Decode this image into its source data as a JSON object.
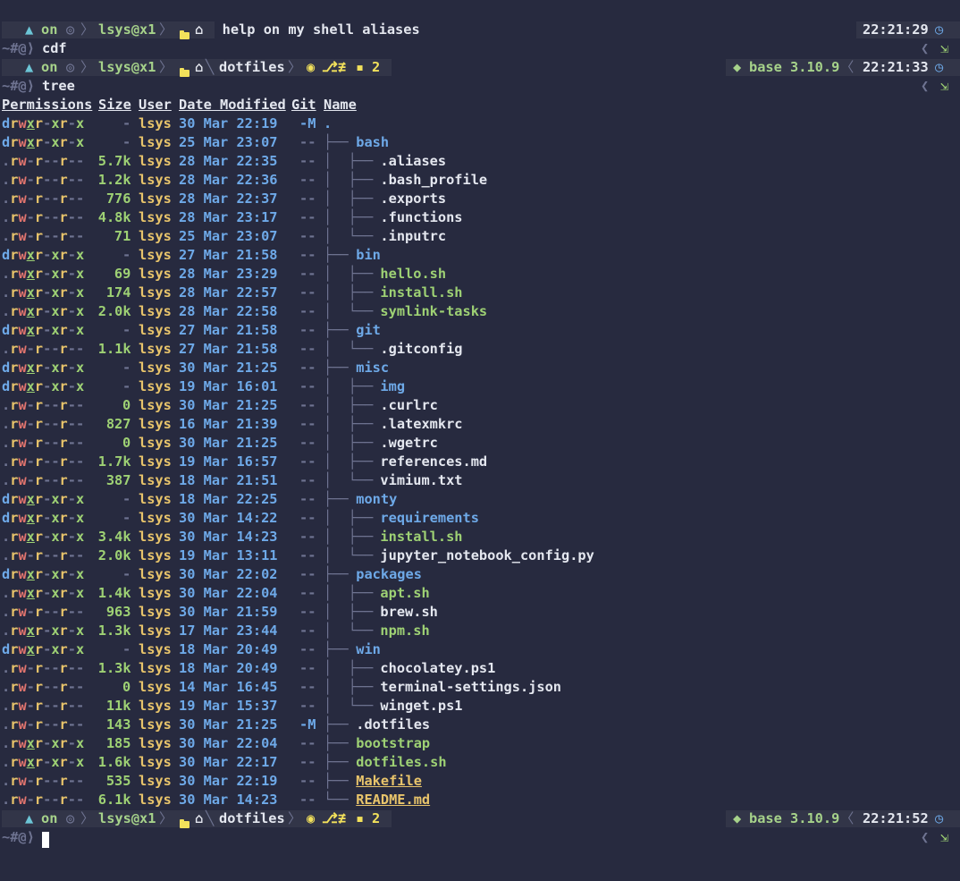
{
  "intro": "Type 'ahelp' for quick help on my shell aliases",
  "prompt": {
    "os_icon": "▲",
    "on": "on",
    "ssh_icon": "◎",
    "user_host": "lsys@x1",
    "folder_icon": "folder-icon",
    "home_icon": "⌂",
    "dir": "dotfiles",
    "git_icon": "",
    "git_branch_icon": "",
    "git_diverge_icon": "≢",
    "git_save_icon": "💾",
    "git_count": "2",
    "python_icon": "🐍",
    "env": "base 3.10.9",
    "clock_icon": "◷",
    "ps": "~#@⟩",
    "right_arrow": "❮",
    "exit_icon": "⇲"
  },
  "prompts": [
    {
      "time": "22:21:29",
      "command": "cdf"
    },
    {
      "time": "22:21:33",
      "command": "tree"
    },
    {
      "time": "22:21:52",
      "command": ""
    }
  ],
  "headers": [
    "Permissions",
    "Size",
    "User",
    "Date Modified",
    "Git",
    "Name"
  ],
  "rows": [
    {
      "perm": "drwxr-xr-x",
      "size": "-",
      "user": "lsys",
      "date": "30 Mar 22:19",
      "git": "-M",
      "tree": "",
      "name": ".",
      "type": "dir"
    },
    {
      "perm": "drwxr-xr-x",
      "size": "-",
      "user": "lsys",
      "date": "25 Mar 23:07",
      "git": "--",
      "tree": "├── ",
      "name": "bash",
      "type": "dir"
    },
    {
      "perm": ".rw-r--r--",
      "size": "5.7k",
      "user": "lsys",
      "date": "28 Mar 22:35",
      "git": "--",
      "tree": "│  ├── ",
      "name": ".aliases",
      "type": "file"
    },
    {
      "perm": ".rw-r--r--",
      "size": "1.2k",
      "user": "lsys",
      "date": "28 Mar 22:36",
      "git": "--",
      "tree": "│  ├── ",
      "name": ".bash_profile",
      "type": "file"
    },
    {
      "perm": ".rw-r--r--",
      "size": "776",
      "user": "lsys",
      "date": "28 Mar 22:37",
      "git": "--",
      "tree": "│  ├── ",
      "name": ".exports",
      "type": "file"
    },
    {
      "perm": ".rw-r--r--",
      "size": "4.8k",
      "user": "lsys",
      "date": "28 Mar 23:17",
      "git": "--",
      "tree": "│  ├── ",
      "name": ".functions",
      "type": "file"
    },
    {
      "perm": ".rw-r--r--",
      "size": "71",
      "user": "lsys",
      "date": "25 Mar 23:07",
      "git": "--",
      "tree": "│  └── ",
      "name": ".inputrc",
      "type": "file"
    },
    {
      "perm": "drwxr-xr-x",
      "size": "-",
      "user": "lsys",
      "date": "27 Mar 21:58",
      "git": "--",
      "tree": "├── ",
      "name": "bin",
      "type": "dir"
    },
    {
      "perm": ".rwxr-xr-x",
      "size": "69",
      "user": "lsys",
      "date": "28 Mar 23:29",
      "git": "--",
      "tree": "│  ├── ",
      "name": "hello.sh",
      "type": "exec"
    },
    {
      "perm": ".rwxr-xr-x",
      "size": "174",
      "user": "lsys",
      "date": "28 Mar 22:57",
      "git": "--",
      "tree": "│  ├── ",
      "name": "install.sh",
      "type": "exec"
    },
    {
      "perm": ".rwxr-xr-x",
      "size": "2.0k",
      "user": "lsys",
      "date": "28 Mar 22:58",
      "git": "--",
      "tree": "│  └── ",
      "name": "symlink-tasks",
      "type": "exec"
    },
    {
      "perm": "drwxr-xr-x",
      "size": "-",
      "user": "lsys",
      "date": "27 Mar 21:58",
      "git": "--",
      "tree": "├── ",
      "name": "git",
      "type": "dir"
    },
    {
      "perm": ".rw-r--r--",
      "size": "1.1k",
      "user": "lsys",
      "date": "27 Mar 21:58",
      "git": "--",
      "tree": "│  └── ",
      "name": ".gitconfig",
      "type": "file"
    },
    {
      "perm": "drwxr-xr-x",
      "size": "-",
      "user": "lsys",
      "date": "30 Mar 21:25",
      "git": "--",
      "tree": "├── ",
      "name": "misc",
      "type": "dir"
    },
    {
      "perm": "drwxr-xr-x",
      "size": "-",
      "user": "lsys",
      "date": "19 Mar 16:01",
      "git": "--",
      "tree": "│  ├── ",
      "name": "img",
      "type": "dir"
    },
    {
      "perm": ".rw-r--r--",
      "size": "0",
      "user": "lsys",
      "date": "30 Mar 21:25",
      "git": "--",
      "tree": "│  ├── ",
      "name": ".curlrc",
      "type": "file"
    },
    {
      "perm": ".rw-r--r--",
      "size": "827",
      "user": "lsys",
      "date": "16 Mar 21:39",
      "git": "--",
      "tree": "│  ├── ",
      "name": ".latexmkrc",
      "type": "file"
    },
    {
      "perm": ".rw-r--r--",
      "size": "0",
      "user": "lsys",
      "date": "30 Mar 21:25",
      "git": "--",
      "tree": "│  ├── ",
      "name": ".wgetrc",
      "type": "file"
    },
    {
      "perm": ".rw-r--r--",
      "size": "1.7k",
      "user": "lsys",
      "date": "19 Mar 16:57",
      "git": "--",
      "tree": "│  ├── ",
      "name": "references.md",
      "type": "file"
    },
    {
      "perm": ".rw-r--r--",
      "size": "387",
      "user": "lsys",
      "date": "18 Mar 21:51",
      "git": "--",
      "tree": "│  └── ",
      "name": "vimium.txt",
      "type": "file"
    },
    {
      "perm": "drwxr-xr-x",
      "size": "-",
      "user": "lsys",
      "date": "18 Mar 22:25",
      "git": "--",
      "tree": "├── ",
      "name": "monty",
      "type": "dir"
    },
    {
      "perm": "drwxr-xr-x",
      "size": "-",
      "user": "lsys",
      "date": "30 Mar 14:22",
      "git": "--",
      "tree": "│  ├── ",
      "name": "requirements",
      "type": "dir"
    },
    {
      "perm": ".rwxr-xr-x",
      "size": "3.4k",
      "user": "lsys",
      "date": "30 Mar 14:23",
      "git": "--",
      "tree": "│  ├── ",
      "name": "install.sh",
      "type": "exec"
    },
    {
      "perm": ".rw-r--r--",
      "size": "2.0k",
      "user": "lsys",
      "date": "19 Mar 13:11",
      "git": "--",
      "tree": "│  └── ",
      "name": "jupyter_notebook_config.py",
      "type": "file"
    },
    {
      "perm": "drwxr-xr-x",
      "size": "-",
      "user": "lsys",
      "date": "30 Mar 22:02",
      "git": "--",
      "tree": "├── ",
      "name": "packages",
      "type": "dir"
    },
    {
      "perm": ".rwxr-xr-x",
      "size": "1.4k",
      "user": "lsys",
      "date": "30 Mar 22:04",
      "git": "--",
      "tree": "│  ├── ",
      "name": "apt.sh",
      "type": "exec"
    },
    {
      "perm": ".rw-r--r--",
      "size": "963",
      "user": "lsys",
      "date": "30 Mar 21:59",
      "git": "--",
      "tree": "│  ├── ",
      "name": "brew.sh",
      "type": "file"
    },
    {
      "perm": ".rwxr-xr-x",
      "size": "1.3k",
      "user": "lsys",
      "date": "17 Mar 23:44",
      "git": "--",
      "tree": "│  └── ",
      "name": "npm.sh",
      "type": "exec"
    },
    {
      "perm": "drwxr-xr-x",
      "size": "-",
      "user": "lsys",
      "date": "18 Mar 20:49",
      "git": "--",
      "tree": "├── ",
      "name": "win",
      "type": "dir"
    },
    {
      "perm": ".rw-r--r--",
      "size": "1.3k",
      "user": "lsys",
      "date": "18 Mar 20:49",
      "git": "--",
      "tree": "│  ├── ",
      "name": "chocolatey.ps1",
      "type": "file"
    },
    {
      "perm": ".rw-r--r--",
      "size": "0",
      "user": "lsys",
      "date": "14 Mar 16:45",
      "git": "--",
      "tree": "│  ├── ",
      "name": "terminal-settings.json",
      "type": "file"
    },
    {
      "perm": ".rw-r--r--",
      "size": "11k",
      "user": "lsys",
      "date": "19 Mar 15:37",
      "git": "--",
      "tree": "│  └── ",
      "name": "winget.ps1",
      "type": "file"
    },
    {
      "perm": ".rw-r--r--",
      "size": "143",
      "user": "lsys",
      "date": "30 Mar 21:25",
      "git": "-M",
      "tree": "├── ",
      "name": ".dotfiles",
      "type": "file"
    },
    {
      "perm": ".rwxr-xr-x",
      "size": "185",
      "user": "lsys",
      "date": "30 Mar 22:04",
      "git": "--",
      "tree": "├── ",
      "name": "bootstrap",
      "type": "exec"
    },
    {
      "perm": ".rwxr-xr-x",
      "size": "1.6k",
      "user": "lsys",
      "date": "30 Mar 22:17",
      "git": "--",
      "tree": "├── ",
      "name": "dotfiles.sh",
      "type": "exec"
    },
    {
      "perm": ".rw-r--r--",
      "size": "535",
      "user": "lsys",
      "date": "30 Mar 22:19",
      "git": "--",
      "tree": "├── ",
      "name": "Makefile",
      "type": "special"
    },
    {
      "perm": ".rw-r--r--",
      "size": "6.1k",
      "user": "lsys",
      "date": "30 Mar 14:23",
      "git": "--",
      "tree": "└── ",
      "name": "README.md",
      "type": "special"
    }
  ]
}
